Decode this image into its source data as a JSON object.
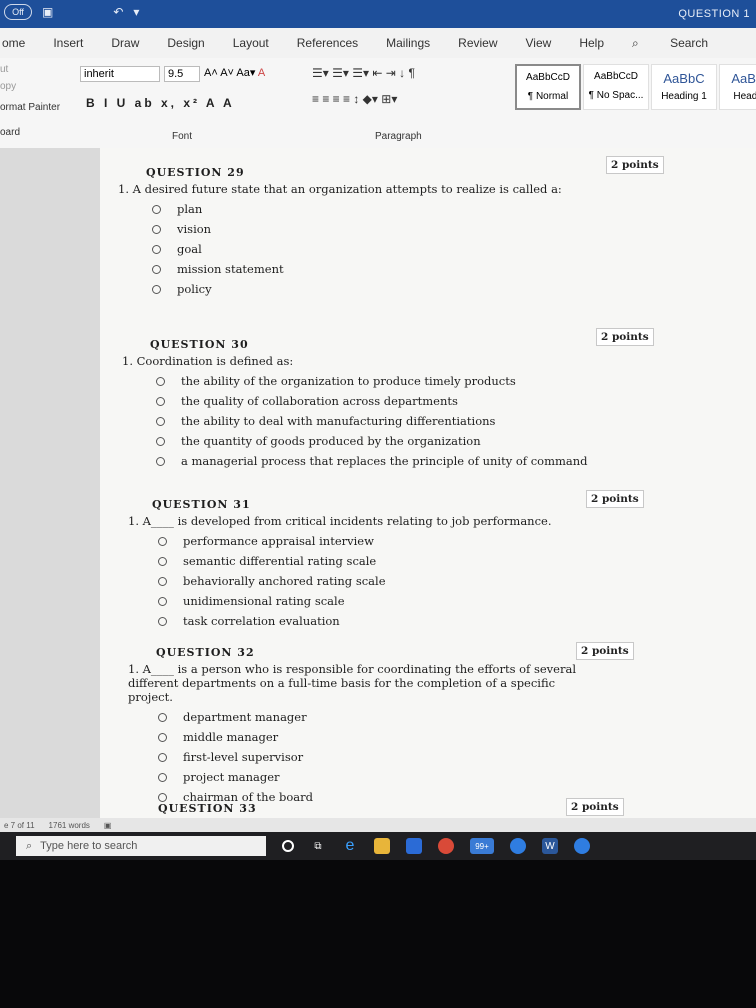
{
  "titlebar": {
    "autosave": "Off",
    "title": "QUESTION 1"
  },
  "tabs": [
    "ome",
    "Insert",
    "Draw",
    "Design",
    "Layout",
    "References",
    "Mailings",
    "Review",
    "View",
    "Help",
    "Search"
  ],
  "ribbon": {
    "clipboard": {
      "cut": "ut",
      "copy": "opy",
      "format_painter": "ormat Painter",
      "label": "oard"
    },
    "font": {
      "name": "inherit",
      "size": "9.5",
      "label": "Font",
      "row2": "B I U ab x, x² A A"
    },
    "paragraph": {
      "label": "Paragraph"
    },
    "styles": [
      {
        "preview": "AaBbCcD",
        "label": "¶ Normal"
      },
      {
        "preview": "AaBbCcD",
        "label": "¶ No Spac..."
      },
      {
        "preview": "AaBbC",
        "label": "Heading 1"
      },
      {
        "preview": "AaBbC",
        "label": "Heading"
      }
    ]
  },
  "questions": [
    {
      "head": "QUESTION 29",
      "points": "2 points",
      "text": "1.  A desired future state that an organization attempts to realize is called a:",
      "options": [
        "plan",
        "vision",
        "goal",
        "mission statement",
        "policy"
      ]
    },
    {
      "head": "QUESTION 30",
      "points": "2 points",
      "text": "1.  Coordination is defined as:",
      "options": [
        "the ability of the organization to produce timely products",
        "the quality of collaboration across departments",
        "the ability to deal with manufacturing differentiations",
        "the quantity of goods produced by the organization",
        "a managerial process that replaces the principle of unity of command"
      ]
    },
    {
      "head": "QUESTION 31",
      "points": "2 points",
      "text": "1.  A____ is developed from critical incidents relating to job performance.",
      "options": [
        "performance appraisal interview",
        "semantic differential rating scale",
        "behaviorally anchored rating scale",
        "unidimensional rating scale",
        "task correlation evaluation"
      ]
    },
    {
      "head": "QUESTION 32",
      "points": "2 points",
      "text": "1.  A____ is a person who is responsible for coordinating the efforts of several different departments on a full-time basis for the completion of a specific project.",
      "options": [
        "department manager",
        "middle manager",
        "first-level supervisor",
        "project manager",
        "chairman of the board"
      ]
    },
    {
      "head": "QUESTION 33",
      "points": "2 points",
      "text": "",
      "options": []
    }
  ],
  "status": {
    "page": "e 7 of 11",
    "words": "1761 words"
  },
  "taskbar": {
    "search_placeholder": "Type here to search",
    "badge": "99+"
  }
}
